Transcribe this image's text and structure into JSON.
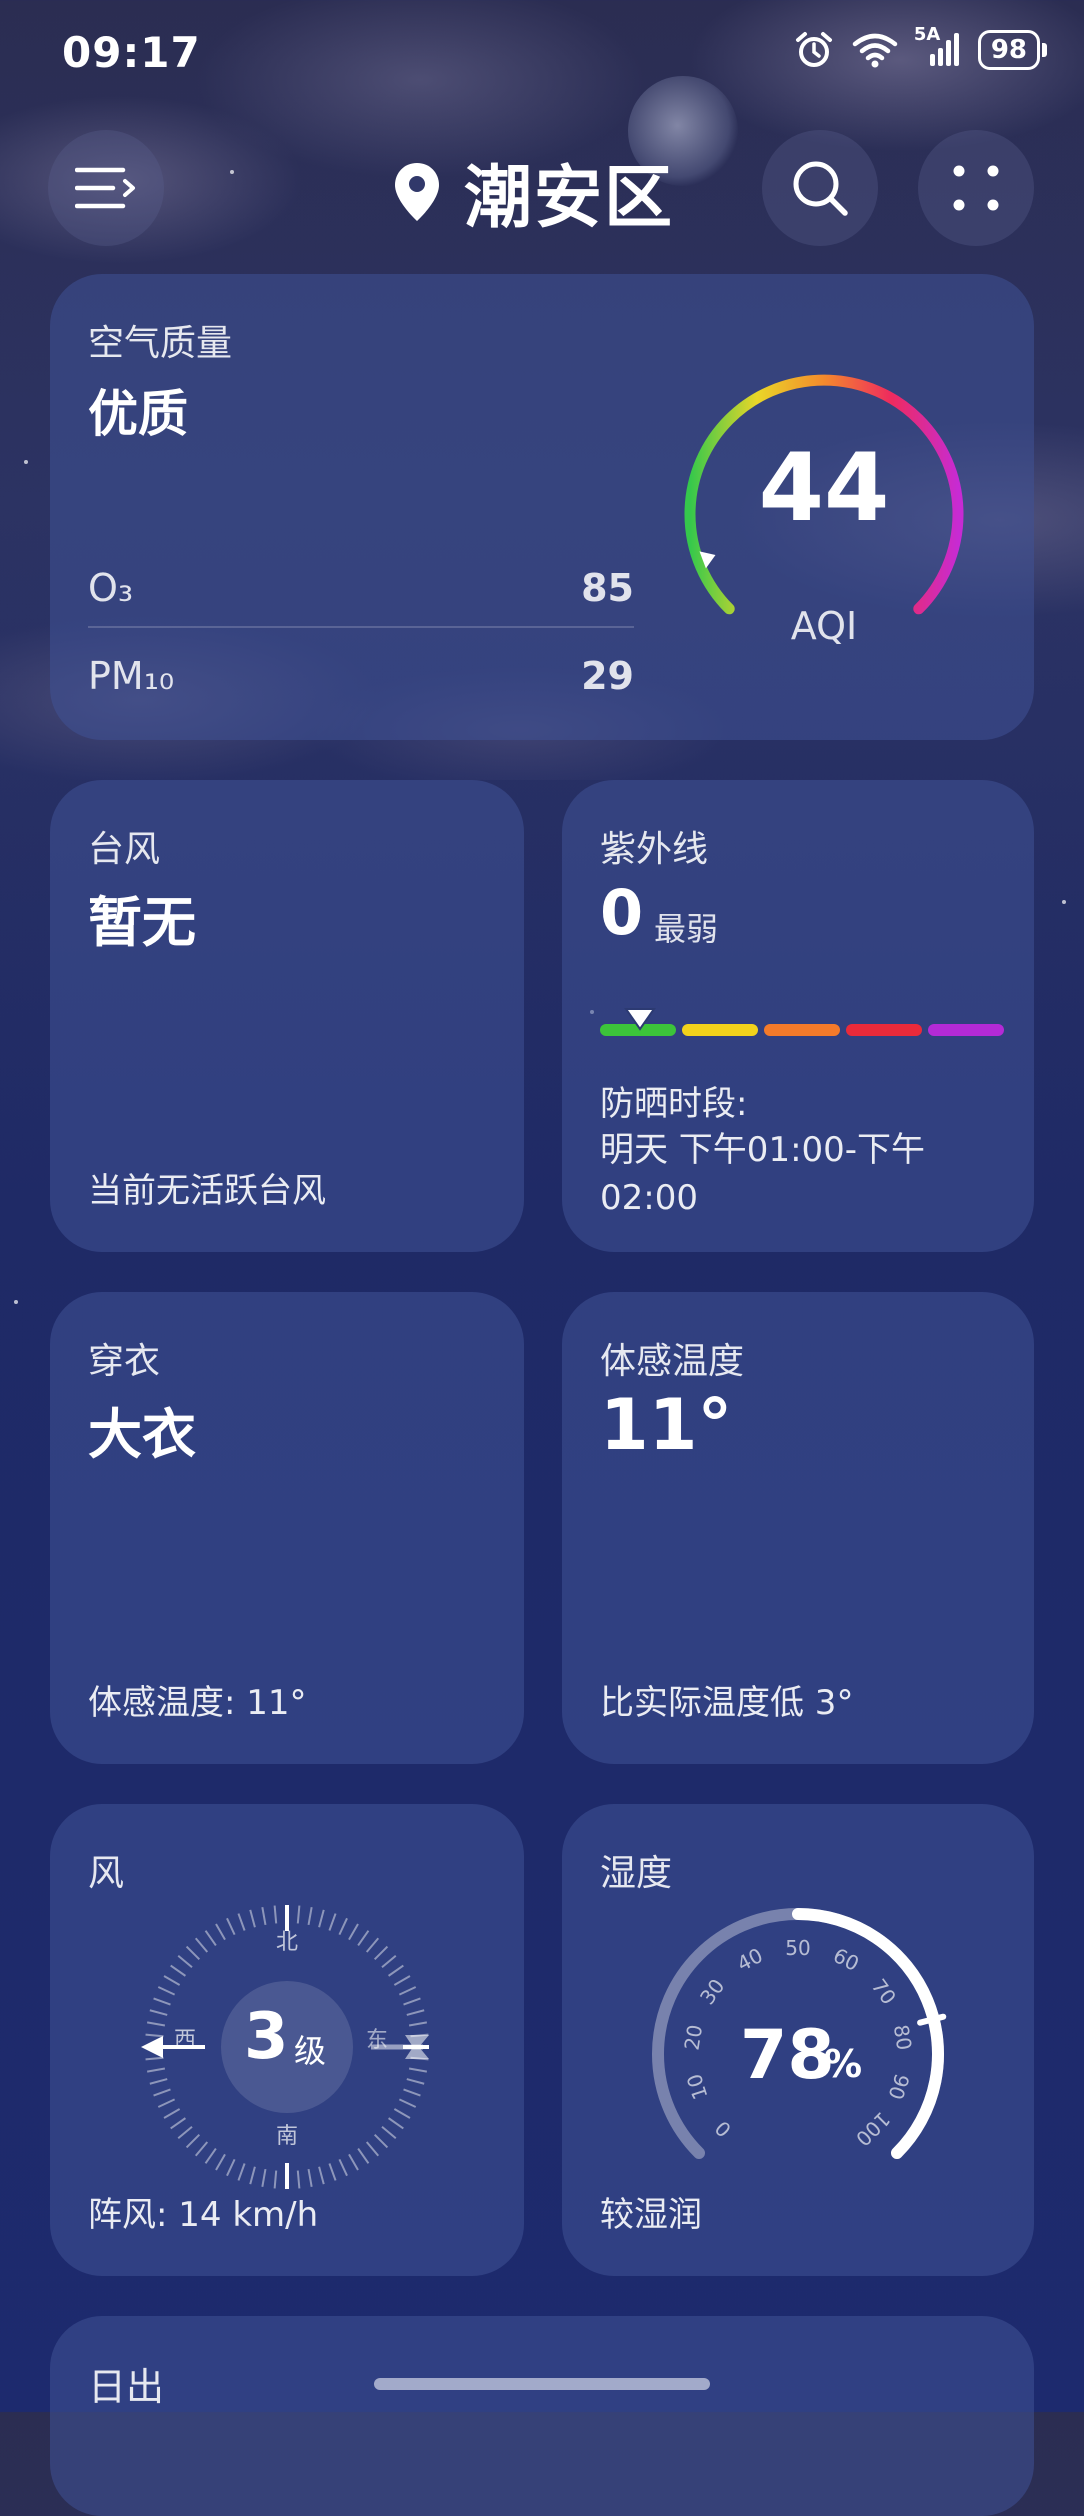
{
  "status_bar": {
    "time": "09:17",
    "network": "5A",
    "battery": "98"
  },
  "header": {
    "location": "潮安区"
  },
  "air_quality": {
    "title": "空气质量",
    "level": "优质",
    "aqi": "44",
    "aqi_label": "AQI",
    "aqi_fraction": 0.09,
    "pollutants": [
      {
        "name": "O₃",
        "value": "85"
      },
      {
        "name": "PM₁₀",
        "value": "29"
      }
    ]
  },
  "typhoon": {
    "title": "台风",
    "value": "暂无",
    "note": "当前无活跃台风"
  },
  "uv": {
    "title": "紫外线",
    "value": "0",
    "level": "最弱",
    "level_fraction": 0.1,
    "colors": [
      "#3cc43a",
      "#f2d21b",
      "#f47a2a",
      "#ea2a3a",
      "#b42ad6"
    ],
    "sunscreen_label": "防晒时段:",
    "sunscreen_time": "明天 下午01:00-下午02:00"
  },
  "clothing": {
    "title": "穿衣",
    "value": "大衣",
    "note": "体感温度: 11°"
  },
  "feels_like": {
    "title": "体感温度",
    "value": "11°",
    "note": "比实际温度低 3°"
  },
  "wind": {
    "title": "风",
    "level": "3",
    "level_unit": "级",
    "dirs": {
      "north": "北",
      "south": "南",
      "east": "东",
      "west": "西"
    },
    "gust": "阵风: 14 km/h"
  },
  "humidity": {
    "title": "湿度",
    "value": "78",
    "unit": "%",
    "fraction": 0.78,
    "ticks": [
      "0",
      "10",
      "20",
      "30",
      "40",
      "50",
      "60",
      "70",
      "80",
      "90",
      "100"
    ],
    "note": "较湿润"
  },
  "sunrise": {
    "title": "日出"
  }
}
